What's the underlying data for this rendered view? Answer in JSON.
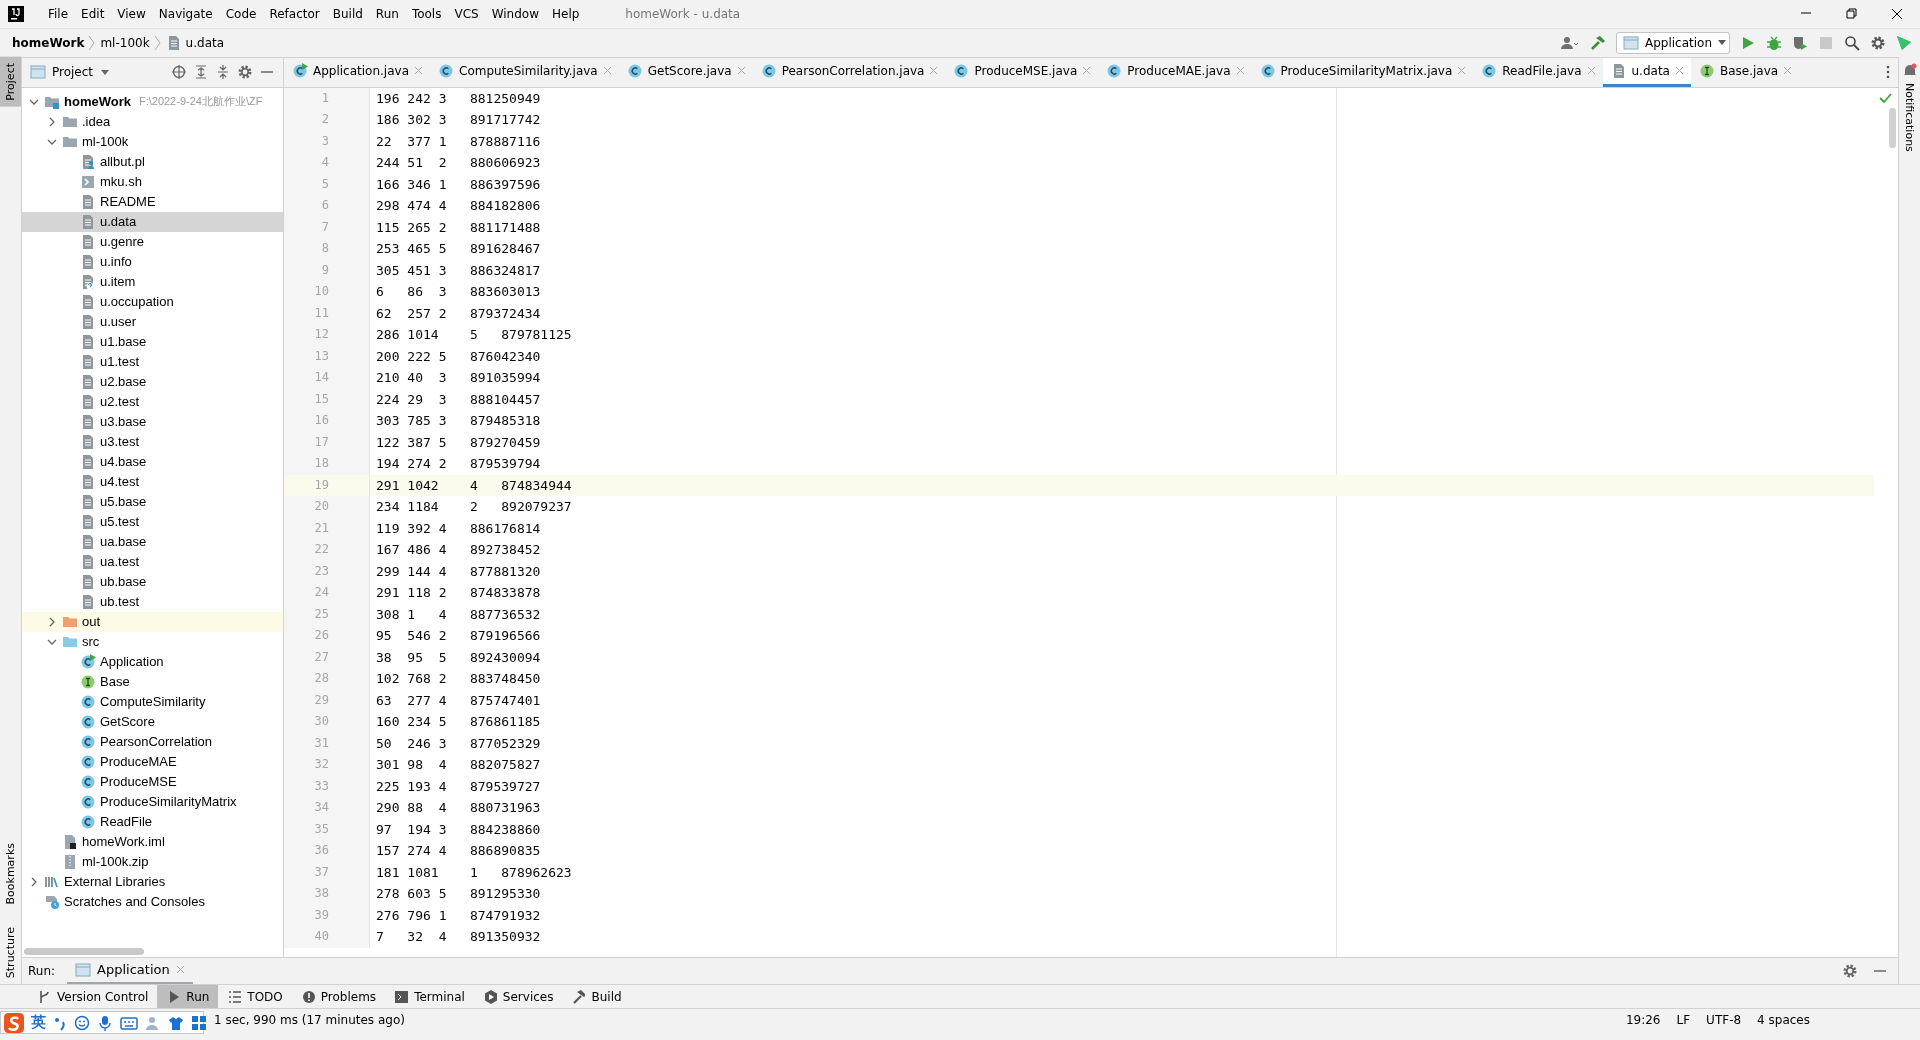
{
  "window": {
    "title": "homeWork - u.data"
  },
  "menu": [
    "File",
    "Edit",
    "View",
    "Navigate",
    "Code",
    "Refactor",
    "Build",
    "Run",
    "Tools",
    "VCS",
    "Window",
    "Help"
  ],
  "breadcrumb": [
    "homeWork",
    "ml-100k",
    "u.data"
  ],
  "run_config": "Application",
  "left_stripe": [
    {
      "label": "Project",
      "selected": true
    },
    {
      "label": "Bookmarks",
      "selected": false
    },
    {
      "label": "Structure",
      "selected": false
    }
  ],
  "right_stripe": [
    "Notifications"
  ],
  "project_panel": {
    "title": "Project"
  },
  "tree": [
    {
      "name": "homeWork",
      "path": "F:\\2022-9-24北航作业\\ZF",
      "kind": "module",
      "expanded": true,
      "selected": false,
      "children": [
        {
          "name": ".idea",
          "kind": "folder",
          "expanded": false,
          "selected": false
        },
        {
          "name": "ml-100k",
          "kind": "folder",
          "expanded": true,
          "selected": false,
          "children": [
            {
              "name": "allbut.pl",
              "kind": "perl",
              "selected": false
            },
            {
              "name": "mku.sh",
              "kind": "script",
              "selected": false
            },
            {
              "name": "README",
              "kind": "text",
              "selected": false
            },
            {
              "name": "u.data",
              "kind": "text",
              "selected": true
            },
            {
              "name": "u.genre",
              "kind": "text",
              "selected": false
            },
            {
              "name": "u.info",
              "kind": "text",
              "selected": false
            },
            {
              "name": "u.item",
              "kind": "unknown",
              "selected": false
            },
            {
              "name": "u.occupation",
              "kind": "text",
              "selected": false
            },
            {
              "name": "u.user",
              "kind": "text",
              "selected": false
            },
            {
              "name": "u1.base",
              "kind": "text",
              "selected": false
            },
            {
              "name": "u1.test",
              "kind": "text",
              "selected": false
            },
            {
              "name": "u2.base",
              "kind": "text",
              "selected": false
            },
            {
              "name": "u2.test",
              "kind": "text",
              "selected": false
            },
            {
              "name": "u3.base",
              "kind": "text",
              "selected": false
            },
            {
              "name": "u3.test",
              "kind": "text",
              "selected": false
            },
            {
              "name": "u4.base",
              "kind": "text",
              "selected": false
            },
            {
              "name": "u4.test",
              "kind": "text",
              "selected": false
            },
            {
              "name": "u5.base",
              "kind": "text",
              "selected": false
            },
            {
              "name": "u5.test",
              "kind": "text",
              "selected": false
            },
            {
              "name": "ua.base",
              "kind": "text",
              "selected": false
            },
            {
              "name": "ua.test",
              "kind": "text",
              "selected": false
            },
            {
              "name": "ub.base",
              "kind": "text",
              "selected": false
            },
            {
              "name": "ub.test",
              "kind": "text",
              "selected": false
            }
          ]
        },
        {
          "name": "out",
          "kind": "excluded",
          "expanded": false,
          "selected": false
        },
        {
          "name": "src",
          "kind": "source",
          "expanded": true,
          "selected": false,
          "children": [
            {
              "name": "Application",
              "kind": "main-class",
              "selected": false
            },
            {
              "name": "Base",
              "kind": "interface",
              "selected": false
            },
            {
              "name": "ComputeSimilarity",
              "kind": "class",
              "selected": false
            },
            {
              "name": "GetScore",
              "kind": "class",
              "selected": false
            },
            {
              "name": "PearsonCorrelation",
              "kind": "class",
              "selected": false
            },
            {
              "name": "ProduceMAE",
              "kind": "class",
              "selected": false
            },
            {
              "name": "ProduceMSE",
              "kind": "class",
              "selected": false
            },
            {
              "name": "ProduceSimilarityMatrix",
              "kind": "class",
              "selected": false
            },
            {
              "name": "ReadFile",
              "kind": "class",
              "selected": false
            }
          ]
        },
        {
          "name": "homeWork.iml",
          "kind": "iml",
          "selected": false
        },
        {
          "name": "ml-100k.zip",
          "kind": "zip",
          "selected": false
        }
      ]
    },
    {
      "name": "External Libraries",
      "kind": "libraries",
      "expanded": false,
      "selected": false
    },
    {
      "name": "Scratches and Consoles",
      "kind": "scratches",
      "selected": false
    }
  ],
  "tabs": [
    {
      "label": "Application.java",
      "kind": "main-class",
      "selected": false
    },
    {
      "label": "ComputeSimilarity.java",
      "kind": "class",
      "selected": false
    },
    {
      "label": "GetScore.java",
      "kind": "class",
      "selected": false
    },
    {
      "label": "PearsonCorrelation.java",
      "kind": "class",
      "selected": false
    },
    {
      "label": "ProduceMSE.java",
      "kind": "class",
      "selected": false
    },
    {
      "label": "ProduceMAE.java",
      "kind": "class",
      "selected": false
    },
    {
      "label": "ProduceSimilarityMatrix.java",
      "kind": "class",
      "selected": false
    },
    {
      "label": "ReadFile.java",
      "kind": "class",
      "selected": false
    },
    {
      "label": "u.data",
      "kind": "text",
      "selected": true
    },
    {
      "label": "Base.java",
      "kind": "interface",
      "selected": false
    }
  ],
  "editor": {
    "lines": [
      {
        "number": "1",
        "text": "196\t242\t3\t881250949",
        "current": false
      },
      {
        "number": "2",
        "text": "186\t302\t3\t891717742",
        "current": false
      },
      {
        "number": "3",
        "text": "22\t377\t1\t878887116",
        "current": false
      },
      {
        "number": "4",
        "text": "244\t51\t2\t880606923",
        "current": false
      },
      {
        "number": "5",
        "text": "166\t346\t1\t886397596",
        "current": false
      },
      {
        "number": "6",
        "text": "298\t474\t4\t884182806",
        "current": false
      },
      {
        "number": "7",
        "text": "115\t265\t2\t881171488",
        "current": false
      },
      {
        "number": "8",
        "text": "253\t465\t5\t891628467",
        "current": false
      },
      {
        "number": "9",
        "text": "305\t451\t3\t886324817",
        "current": false
      },
      {
        "number": "10",
        "text": "6\t86\t3\t883603013",
        "current": false
      },
      {
        "number": "11",
        "text": "62\t257\t2\t879372434",
        "current": false
      },
      {
        "number": "12",
        "text": "286\t1014\t5\t879781125",
        "current": false
      },
      {
        "number": "13",
        "text": "200\t222\t5\t876042340",
        "current": false
      },
      {
        "number": "14",
        "text": "210\t40\t3\t891035994",
        "current": false
      },
      {
        "number": "15",
        "text": "224\t29\t3\t888104457",
        "current": false
      },
      {
        "number": "16",
        "text": "303\t785\t3\t879485318",
        "current": false
      },
      {
        "number": "17",
        "text": "122\t387\t5\t879270459",
        "current": false
      },
      {
        "number": "18",
        "text": "194\t274\t2\t879539794",
        "current": false
      },
      {
        "number": "19",
        "text": "291\t1042\t4\t874834944",
        "current": true
      },
      {
        "number": "20",
        "text": "234\t1184\t2\t892079237",
        "current": false
      },
      {
        "number": "21",
        "text": "119\t392\t4\t886176814",
        "current": false
      },
      {
        "number": "22",
        "text": "167\t486\t4\t892738452",
        "current": false
      },
      {
        "number": "23",
        "text": "299\t144\t4\t877881320",
        "current": false
      },
      {
        "number": "24",
        "text": "291\t118\t2\t874833878",
        "current": false
      },
      {
        "number": "25",
        "text": "308\t1\t4\t887736532",
        "current": false
      },
      {
        "number": "26",
        "text": "95\t546\t2\t879196566",
        "current": false
      },
      {
        "number": "27",
        "text": "38\t95\t5\t892430094",
        "current": false
      },
      {
        "number": "28",
        "text": "102\t768\t2\t883748450",
        "current": false
      },
      {
        "number": "29",
        "text": "63\t277\t4\t875747401",
        "current": false
      },
      {
        "number": "30",
        "text": "160\t234\t5\t876861185",
        "current": false
      },
      {
        "number": "31",
        "text": "50\t246\t3\t877052329",
        "current": false
      },
      {
        "number": "32",
        "text": "301\t98\t4\t882075827",
        "current": false
      },
      {
        "number": "33",
        "text": "225\t193\t4\t879539727",
        "current": false
      },
      {
        "number": "34",
        "text": "290\t88\t4\t880731963",
        "current": false
      },
      {
        "number": "35",
        "text": "97\t194\t3\t884238860",
        "current": false
      },
      {
        "number": "36",
        "text": "157\t274\t4\t886890835",
        "current": false
      },
      {
        "number": "37",
        "text": "181\t1081\t1\t878962623",
        "current": false
      },
      {
        "number": "38",
        "text": "278\t603\t5\t891295330",
        "current": false
      },
      {
        "number": "39",
        "text": "276\t796\t1\t874791932",
        "current": false
      },
      {
        "number": "40",
        "text": "7\t32\t4\t891350932",
        "current": false
      }
    ]
  },
  "run_panel": {
    "label": "Run:",
    "tabs": [
      {
        "label": "Application",
        "selected": true
      }
    ]
  },
  "tool_tabs": [
    {
      "label": "Version Control",
      "kind": "vcs",
      "selected": false
    },
    {
      "label": "Run",
      "kind": "run",
      "selected": true
    },
    {
      "label": "TODO",
      "kind": "todo",
      "selected": false
    },
    {
      "label": "Problems",
      "kind": "problems",
      "selected": false
    },
    {
      "label": "Terminal",
      "kind": "terminal",
      "selected": false
    },
    {
      "label": "Services",
      "kind": "services",
      "selected": false
    },
    {
      "label": "Build",
      "kind": "build",
      "selected": false
    }
  ],
  "status_bar": {
    "message": "1 sec, 990 ms (17 minutes ago)",
    "items": [
      "19:26",
      "LF",
      "UTF-8",
      "4 spaces"
    ]
  },
  "ime_toolbar": {
    "mode": "英"
  }
}
